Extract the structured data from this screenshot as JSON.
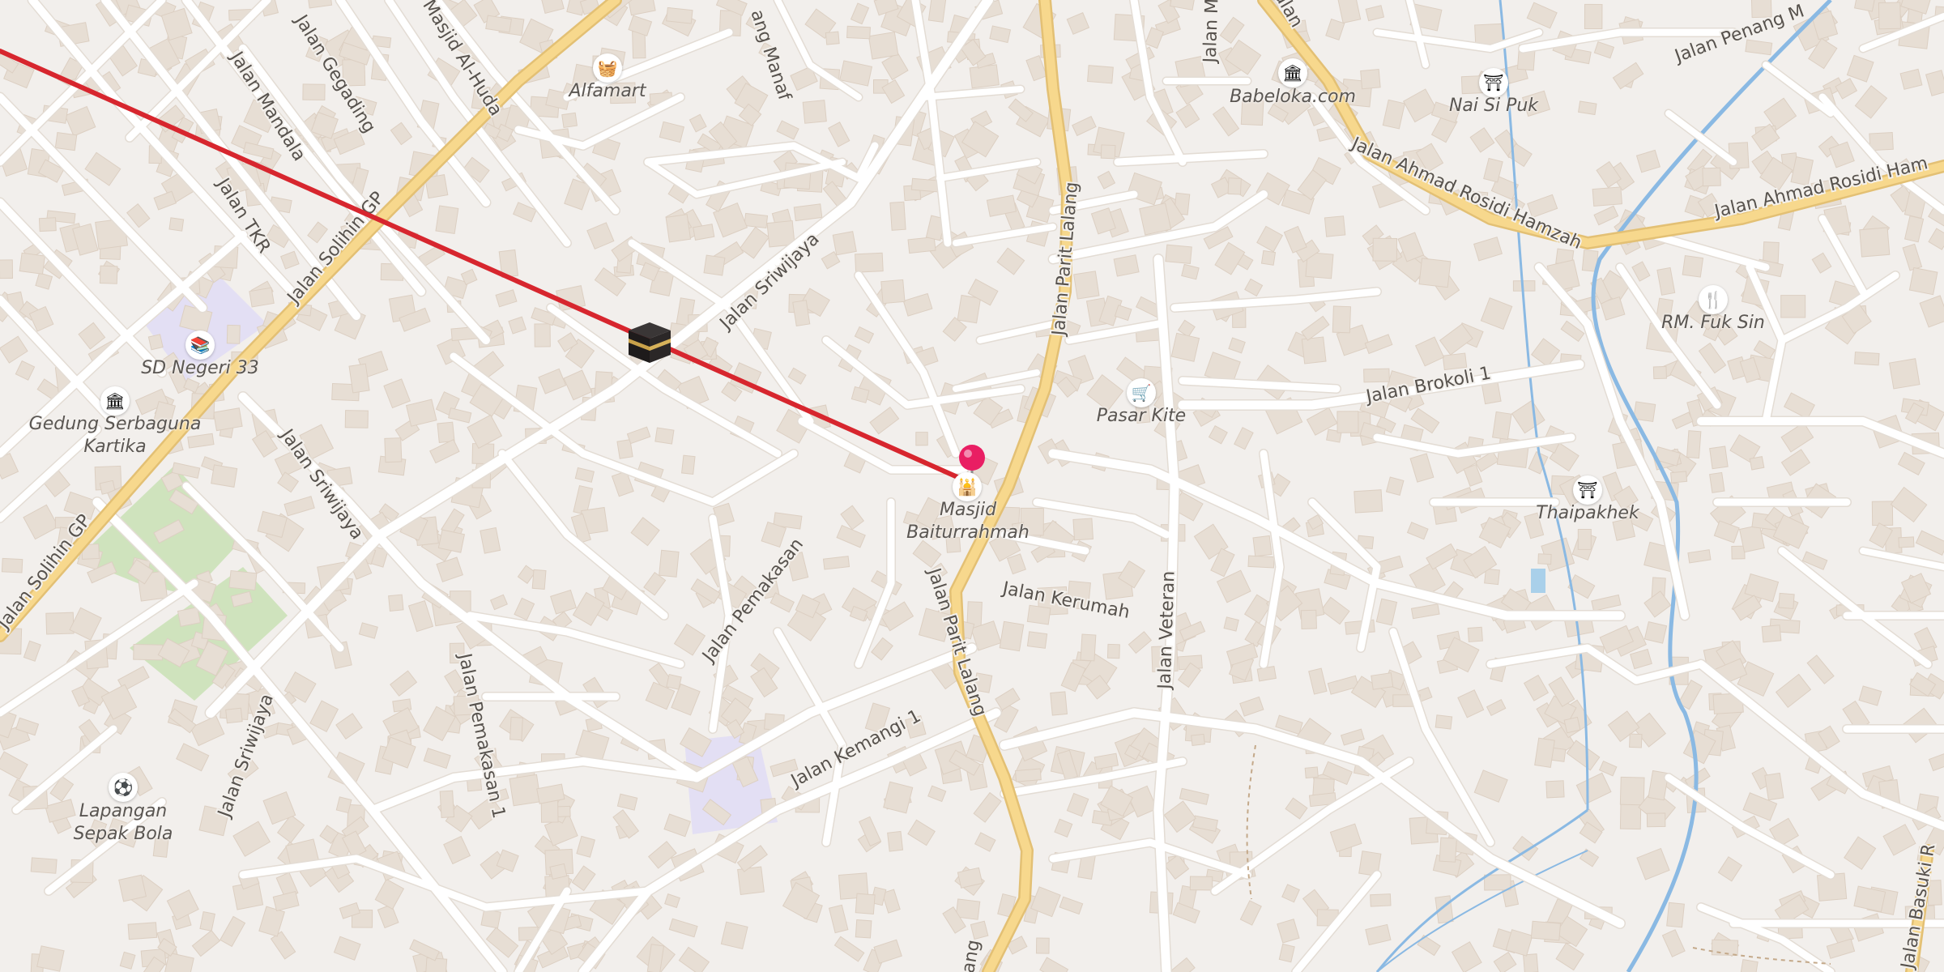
{
  "map": {
    "colors": {
      "background": "#f2efec",
      "minor_road": "#ffffff",
      "major_road_fill": "#f7d88d",
      "major_road_casing": "#e3c074",
      "building": "#e6ddd4",
      "park": "#cfe3bd",
      "school_area": "#e3dff4",
      "river": "#8ab9e3",
      "qibla_line": "#d7262e",
      "pin": "#e91e63"
    },
    "streets": [
      "Jalan Solihin GP",
      "Jalan Solihin GP",
      "Jalan Mandala",
      "Jalan Gegading",
      "Masjid Al-Huda",
      "Jalan TKR",
      "Jalan Sriwijaya",
      "Jalan Sriwijaya",
      "Jalan Sriwijaya",
      "Jalan Pemakasan",
      "Jalan Pemakasan 1",
      "Jalan Kemangi 1",
      "Jalan Parit Lalang",
      "Jalan Parit Lalang",
      "Jalan Kerumah",
      "Jalan Veteran",
      "Jalan Brokoli 1",
      "Jalan Ahmad Rosidi Hamzah",
      "Jalan Ahmad Rosidi Ham",
      "Jalan Penang M",
      "ang Manaf",
      "Jalan Basuki R",
      "lang",
      "Jalan M",
      "alan"
    ],
    "pois": [
      {
        "name": "Alfamart",
        "icon": "shopping-basket-icon",
        "glyph": "🧺"
      },
      {
        "name": "SD Negeri 33",
        "icon": "school-icon",
        "glyph": "📚"
      },
      {
        "name": "Gedung Serbaguna Kartika",
        "icon": "monument-icon",
        "glyph": "🏛"
      },
      {
        "name": "Lapangan Sepak Bola",
        "icon": "soccer-icon",
        "glyph": "⚽"
      },
      {
        "name": "Masjid Baiturrahmah",
        "icon": "mosque-icon",
        "glyph": "🕌"
      },
      {
        "name": "Pasar Kite",
        "icon": "shopping-cart-icon",
        "glyph": "🛒"
      },
      {
        "name": "Babeloka.com",
        "icon": "museum-icon",
        "glyph": "🏛"
      },
      {
        "name": "Nai Si Puk",
        "icon": "temple-icon",
        "glyph": "⛩"
      },
      {
        "name": "RM. Fuk Sin",
        "icon": "restaurant-icon",
        "glyph": "🍴"
      },
      {
        "name": "Thaipakhek",
        "icon": "temple-icon",
        "glyph": "⛩"
      }
    ],
    "kaaba_marker": {
      "icon": "kaaba-icon"
    },
    "location_pin": {
      "icon": "location-pin-icon"
    },
    "qibla_line": {
      "icon": "qibla-direction-line"
    }
  }
}
